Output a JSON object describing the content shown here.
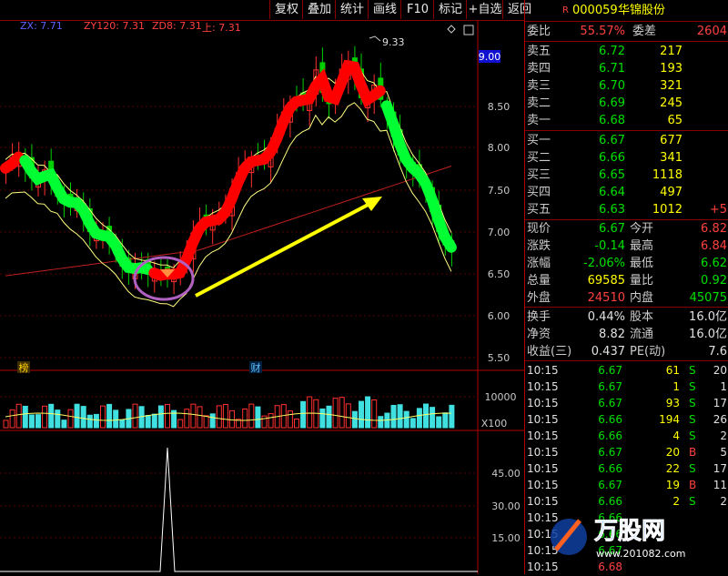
{
  "toolbar": {
    "buttons": [
      "复权",
      "叠加",
      "统计",
      "画线",
      "F10",
      "标记",
      "+自选",
      "返回"
    ]
  },
  "legend": {
    "zx": "ZX: 7.71",
    "zy120": "ZY120: 7.31",
    "zd8": "ZD8: 7.31",
    "shang": "上: 7.31"
  },
  "chart": {
    "high_label": "9.33",
    "current_price_tag": "9.00",
    "price_axis": [
      "8.50",
      "8.00",
      "7.50",
      "7.00",
      "6.50",
      "6.00",
      "5.50"
    ],
    "volume_axis": [
      "10000",
      "X100"
    ],
    "indicator_axis": [
      "45.00",
      "30.00",
      "15.00"
    ],
    "markers": [
      "榜",
      "财"
    ],
    "colors": {
      "up": "#ff3030",
      "down": "#00e0e0",
      "ribbon_up": "#ff0000",
      "ribbon_down": "#00ff33",
      "arrow": "#ffff00",
      "circle": "#b060c0"
    }
  },
  "quote": {
    "flag": "R",
    "code": "000059",
    "name": "华锦股份",
    "weibi_label": "委比",
    "weibi_value": "55.57%",
    "weicha_label": "委差",
    "weicha_value": "2604",
    "sell": [
      {
        "label": "卖五",
        "price": "6.72",
        "vol": "217"
      },
      {
        "label": "卖四",
        "price": "6.71",
        "vol": "193"
      },
      {
        "label": "卖三",
        "price": "6.70",
        "vol": "321"
      },
      {
        "label": "卖二",
        "price": "6.69",
        "vol": "245"
      },
      {
        "label": "卖一",
        "price": "6.68",
        "vol": "65"
      }
    ],
    "buy": [
      {
        "label": "买一",
        "price": "6.67",
        "vol": "677",
        "chg": ""
      },
      {
        "label": "买二",
        "price": "6.66",
        "vol": "341",
        "chg": ""
      },
      {
        "label": "买三",
        "price": "6.65",
        "vol": "1118",
        "chg": ""
      },
      {
        "label": "买四",
        "price": "6.64",
        "vol": "497",
        "chg": ""
      },
      {
        "label": "买五",
        "price": "6.63",
        "vol": "1012",
        "chg": "+5"
      }
    ],
    "stats": [
      {
        "l1": "现价",
        "v1": "6.67",
        "c1": "#00e000",
        "l2": "今开",
        "v2": "6.82",
        "c2": "#ff4040"
      },
      {
        "l1": "涨跌",
        "v1": "-0.14",
        "c1": "#00e000",
        "l2": "最高",
        "v2": "6.84",
        "c2": "#ff4040"
      },
      {
        "l1": "涨幅",
        "v1": "-2.06%",
        "c1": "#00e000",
        "l2": "最低",
        "v2": "6.62",
        "c2": "#00e000"
      },
      {
        "l1": "总量",
        "v1": "69585",
        "c1": "#ffff00",
        "l2": "量比",
        "v2": "0.92",
        "c2": "#00e000"
      },
      {
        "l1": "外盘",
        "v1": "24510",
        "c1": "#ff4040",
        "l2": "内盘",
        "v2": "45075",
        "c2": "#00e000"
      }
    ],
    "stats2": [
      {
        "l1": "换手",
        "v1": "0.44%",
        "l2": "股本",
        "v2": "16.0亿"
      },
      {
        "l1": "净资",
        "v1": "8.82",
        "l2": "流通",
        "v2": "16.0亿"
      },
      {
        "l1": "收益(三)",
        "v1": "0.437",
        "l2": "PE(动)",
        "v2": "7.6"
      }
    ],
    "ticks": [
      {
        "time": "10:15",
        "price": "6.67",
        "vol": "61",
        "side": "S",
        "n": "20"
      },
      {
        "time": "10:15",
        "price": "6.67",
        "vol": "1",
        "side": "S",
        "n": "1"
      },
      {
        "time": "10:15",
        "price": "6.67",
        "vol": "93",
        "side": "S",
        "n": "17"
      },
      {
        "time": "10:15",
        "price": "6.66",
        "vol": "194",
        "side": "S",
        "n": "26"
      },
      {
        "time": "10:15",
        "price": "6.66",
        "vol": "4",
        "side": "S",
        "n": "2"
      },
      {
        "time": "10:15",
        "price": "6.67",
        "vol": "20",
        "side": "B",
        "n": "5"
      },
      {
        "time": "10:15",
        "price": "6.66",
        "vol": "22",
        "side": "S",
        "n": "17"
      },
      {
        "time": "10:15",
        "price": "6.67",
        "vol": "19",
        "side": "B",
        "n": "11"
      },
      {
        "time": "10:15",
        "price": "6.66",
        "vol": "2",
        "side": "S",
        "n": "2"
      },
      {
        "time": "10:15",
        "price": "6.66",
        "vol": "",
        "side": "",
        "n": ""
      },
      {
        "time": "10:15",
        "price": "6.66",
        "vol": "",
        "side": "",
        "n": ""
      },
      {
        "time": "10:15",
        "price": "6.67",
        "vol": "",
        "side": "",
        "n": ""
      },
      {
        "time": "10:15",
        "price": "6.68",
        "vol": "",
        "side": "",
        "n": ""
      }
    ]
  },
  "watermark": {
    "logo": "万股网",
    "url": "www.201082.com"
  }
}
